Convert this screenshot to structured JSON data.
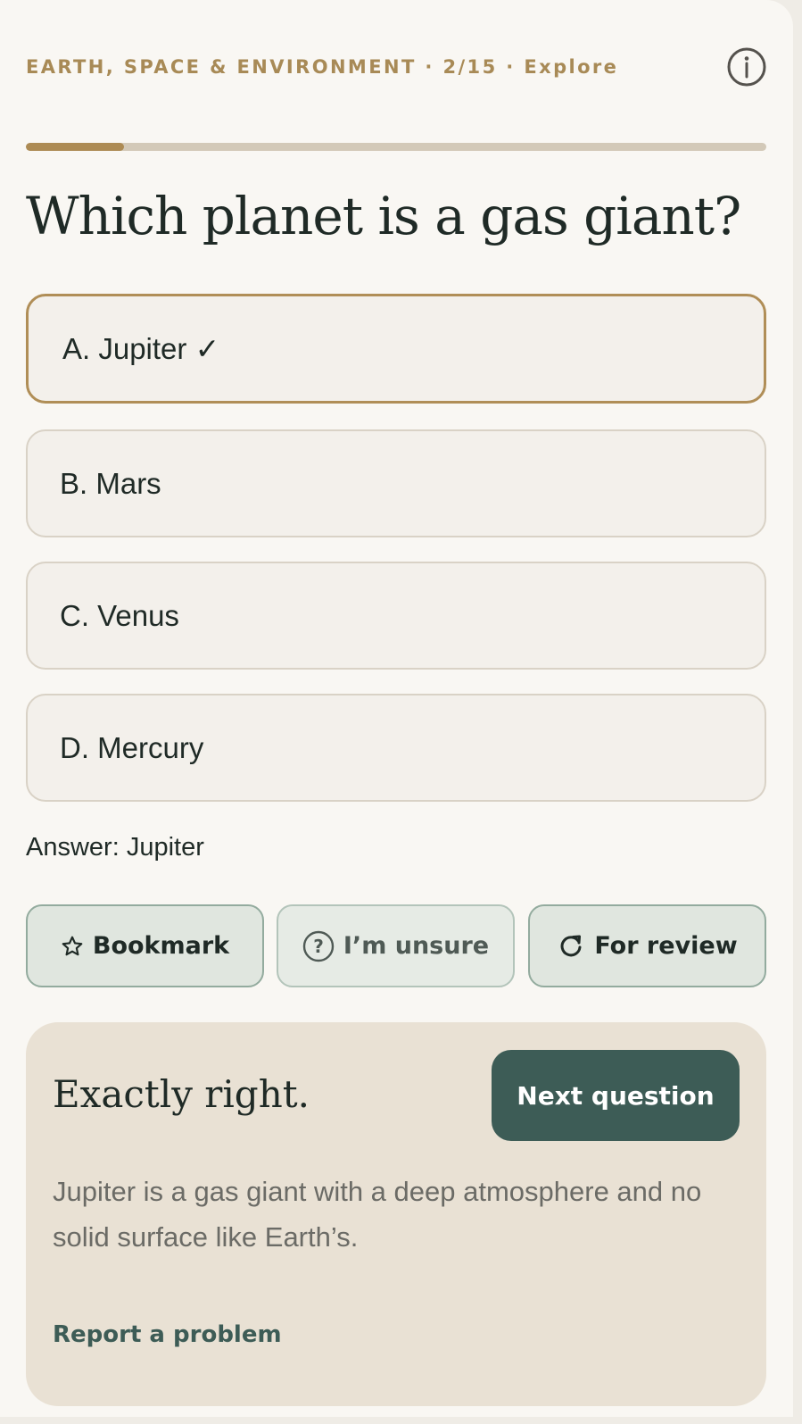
{
  "header": {
    "breadcrumb": "EARTH, SPACE & ENVIRONMENT · 2/15 · Explore",
    "info_icon": "info-circle-icon"
  },
  "progress": {
    "fraction": 0.133,
    "fill_color": "#ad8b54",
    "track_color": "#d3c9b8"
  },
  "question": {
    "text": "Which planet is a gas giant?"
  },
  "options": [
    {
      "label": "A. Jupiter ✓",
      "selected": true
    },
    {
      "label": "B. Mars",
      "selected": false
    },
    {
      "label": "C. Venus",
      "selected": false
    },
    {
      "label": "D. Mercury",
      "selected": false
    }
  ],
  "answer_text": "Answer: Jupiter",
  "actions": {
    "bookmark": {
      "label": "Bookmark",
      "icon": "star-icon"
    },
    "unsure": {
      "label": "I’m unsure",
      "icon": "question-circle-icon"
    },
    "review": {
      "label": "For review",
      "icon": "refresh-icon"
    }
  },
  "feedback": {
    "title": "Exactly right.",
    "next_label": "Next question",
    "explanation": "Jupiter is a gas giant with a deep atmosphere and no solid surface like Earth’s.",
    "report_label": "Report a problem"
  },
  "colors": {
    "accent_gold": "#a88a56",
    "primary_green": "#3d5c56",
    "feedback_bg": "#e9e1d4"
  }
}
